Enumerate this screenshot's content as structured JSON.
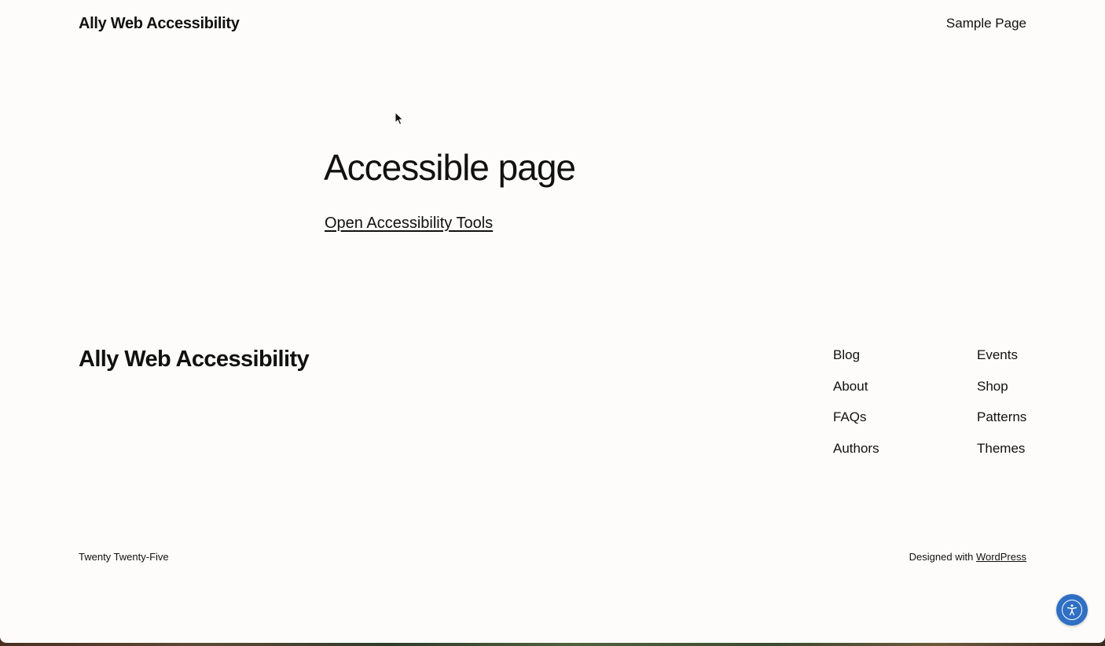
{
  "header": {
    "site_title": "Ally Web Accessibility",
    "nav": [
      "Sample Page"
    ]
  },
  "main": {
    "heading": "Accessible page",
    "link_text": "Open Accessibility Tools"
  },
  "footer": {
    "site_title": "Ally Web Accessibility",
    "nav_col_1": [
      "Blog",
      "About",
      "FAQs",
      "Authors"
    ],
    "nav_col_2": [
      "Events",
      "Shop",
      "Patterns",
      "Themes"
    ],
    "theme_credit": "Twenty Twenty-Five",
    "designed_with_prefix": "Designed with ",
    "designed_with_link": "WordPress"
  },
  "widget": {
    "icon": "accessibility-icon",
    "color": "#2f6fc4"
  },
  "colors": {
    "background": "#fdfcfa",
    "text": "#111111"
  }
}
